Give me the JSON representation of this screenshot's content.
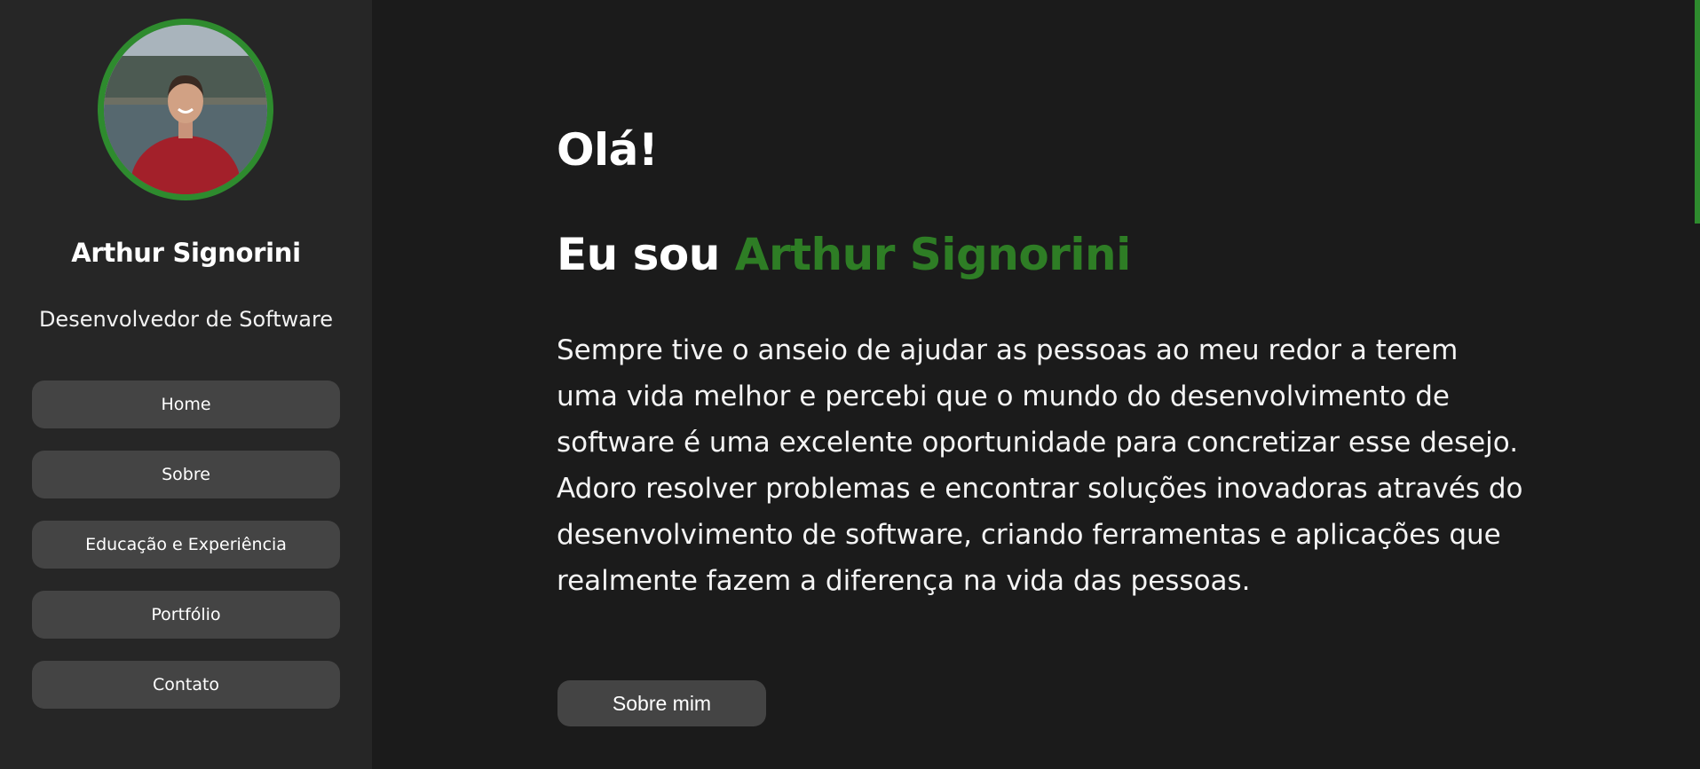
{
  "sidebar": {
    "profile": {
      "name": "Arthur Signorini",
      "role": "Desenvolvedor de Software"
    },
    "nav": [
      {
        "label": "Home"
      },
      {
        "label": "Sobre"
      },
      {
        "label": "Educação e Experiência"
      },
      {
        "label": "Portfólio"
      },
      {
        "label": "Contato"
      }
    ]
  },
  "main": {
    "greeting": "Olá!",
    "intro_prefix": "Eu sou ",
    "intro_name": "Arthur Signorini",
    "bio": "Sempre tive o anseio de ajudar as pessoas ao meu redor a terem uma vida melhor e percebi que o mundo do desenvolvimento de software é uma excelente oportunidade para concretizar esse desejo. Adoro resolver problemas e encontrar soluções inovadoras através do desenvolvimento de software, criando ferramentas e aplicações que realmente fazem a diferença na vida das pessoas.",
    "cta_label": "Sobre mim"
  },
  "colors": {
    "accent": "#2e7d25",
    "sidebar_bg": "#262626",
    "page_bg": "#1b1b1b",
    "button_bg": "#444444"
  }
}
